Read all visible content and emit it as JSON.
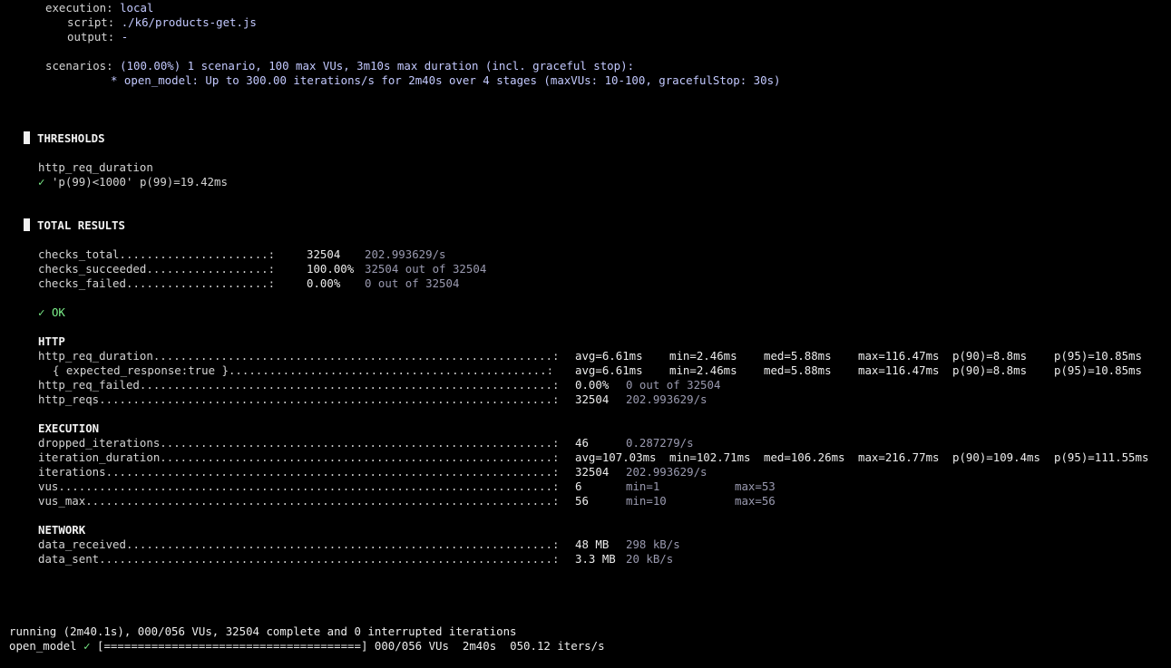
{
  "header": {
    "execution_label": "execution:",
    "execution_value": "local",
    "script_label": "script:",
    "script_value": "./k6/products-get.js",
    "output_label": "output:",
    "output_value": "-",
    "scenarios_label": "scenarios:",
    "scenarios_value": "(100.00%) 1 scenario, 100 max VUs, 3m10s max duration (incl. graceful stop):",
    "scenario_item": "* open_model: Up to 300.00 iterations/s for 2m40s over 4 stages (maxVUs: 10-100, gracefulStop: 30s)"
  },
  "thresholds": {
    "title": "THRESHOLDS",
    "metric": "http_req_duration",
    "check_mark": "✓",
    "rule": "'p(99)<1000'",
    "result": "p(99)=19.42ms"
  },
  "total_results": {
    "title": "TOTAL RESULTS",
    "checks_total": {
      "label": "checks_total",
      "dots": "......................:",
      "value": "32504",
      "extra": "202.993629/s"
    },
    "checks_succeeded": {
      "label": "checks_succeeded",
      "dots": "..................:",
      "value": "100.00%",
      "extra": "32504 out of 32504"
    },
    "checks_failed": {
      "label": "checks_failed",
      "dots": ".....................:",
      "value": "0.00%",
      "extra": "0 out of 32504"
    },
    "ok_mark": "✓",
    "ok_label": "OK"
  },
  "http": {
    "title": "HTTP",
    "req_duration": {
      "label": "http_req_duration",
      "dots": "...........................................................:",
      "avg": "avg=6.61ms",
      "min": "min=2.46ms",
      "med": "med=5.88ms",
      "max": "max=116.47ms",
      "p90": "p(90)=8.8ms",
      "p95": "p(95)=10.85ms"
    },
    "expected_response": {
      "label": "{ expected_response:true }",
      "dots": "...............................................:",
      "avg": "avg=6.61ms",
      "min": "min=2.46ms",
      "med": "med=5.88ms",
      "max": "max=116.47ms",
      "p90": "p(90)=8.8ms",
      "p95": "p(95)=10.85ms"
    },
    "req_failed": {
      "label": "http_req_failed",
      "dots": ".............................................................:",
      "value": "0.00%",
      "extra": "0 out of 32504"
    },
    "reqs": {
      "label": "http_reqs",
      "dots": "...................................................................:",
      "value": "32504",
      "extra": "202.993629/s"
    }
  },
  "execution": {
    "title": "EXECUTION",
    "dropped_iterations": {
      "label": "dropped_iterations",
      "dots": "..........................................................:",
      "value": "46",
      "extra": "0.287279/s"
    },
    "iteration_duration": {
      "label": "iteration_duration",
      "dots": "..........................................................:",
      "avg": "avg=107.03ms",
      "min": "min=102.71ms",
      "med": "med=106.26ms",
      "max": "max=216.77ms",
      "p90": "p(90)=109.4ms",
      "p95": "p(95)=111.55ms"
    },
    "iterations": {
      "label": "iterations",
      "dots": "..................................................................:",
      "value": "32504",
      "extra": "202.993629/s"
    },
    "vus": {
      "label": "vus",
      "dots": ".........................................................................:",
      "value": "6",
      "min": "min=1",
      "max": "max=53"
    },
    "vus_max": {
      "label": "vus_max",
      "dots": ".....................................................................:",
      "value": "56",
      "min": "min=10",
      "max": "max=56"
    }
  },
  "network": {
    "title": "NETWORK",
    "data_received": {
      "label": "data_received",
      "dots": "...............................................................:",
      "value": "48 MB",
      "extra": "298 kB/s"
    },
    "data_sent": {
      "label": "data_sent",
      "dots": "...................................................................:",
      "value": "3.3 MB",
      "extra": "20 kB/s"
    }
  },
  "footer": {
    "running_line": "running (2m40.1s), 000/056 VUs, 32504 complete and 0 interrupted iterations",
    "scenario_name": "open_model",
    "check_mark": "✓",
    "progress_bar": "[======================================]",
    "progress_fraction": 1.0,
    "vus": "000/056 VUs",
    "duration": "2m40s",
    "rate": "050.12 iters/s"
  }
}
